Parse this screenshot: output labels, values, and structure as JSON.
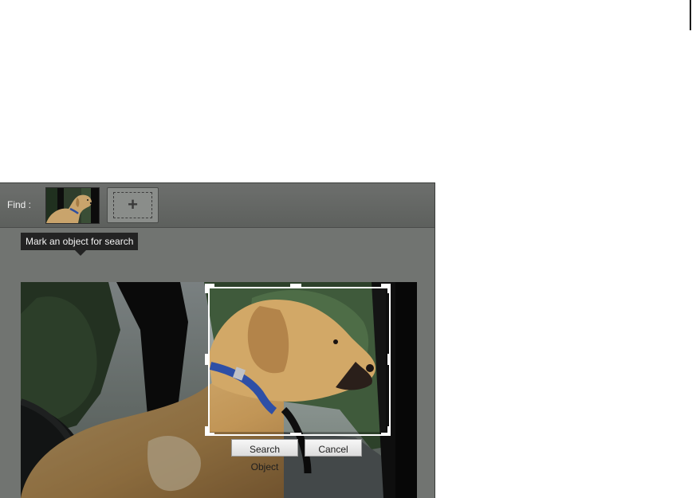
{
  "find_bar": {
    "label": "Find :",
    "thumbnail_icon": "dog-thumbnail-image",
    "add_button_icon": "plus-icon",
    "add_button_glyph": "+"
  },
  "tooltip": {
    "text": "Mark an object for search"
  },
  "photo": {
    "subject_icon": "dog-photo-image"
  },
  "selection": {
    "search_button": "Search Object",
    "cancel_button": "Cancel"
  },
  "colors": {
    "panel_bg": "#717471",
    "tooltip_bg": "#232323",
    "selection_border": "#ffffff"
  }
}
